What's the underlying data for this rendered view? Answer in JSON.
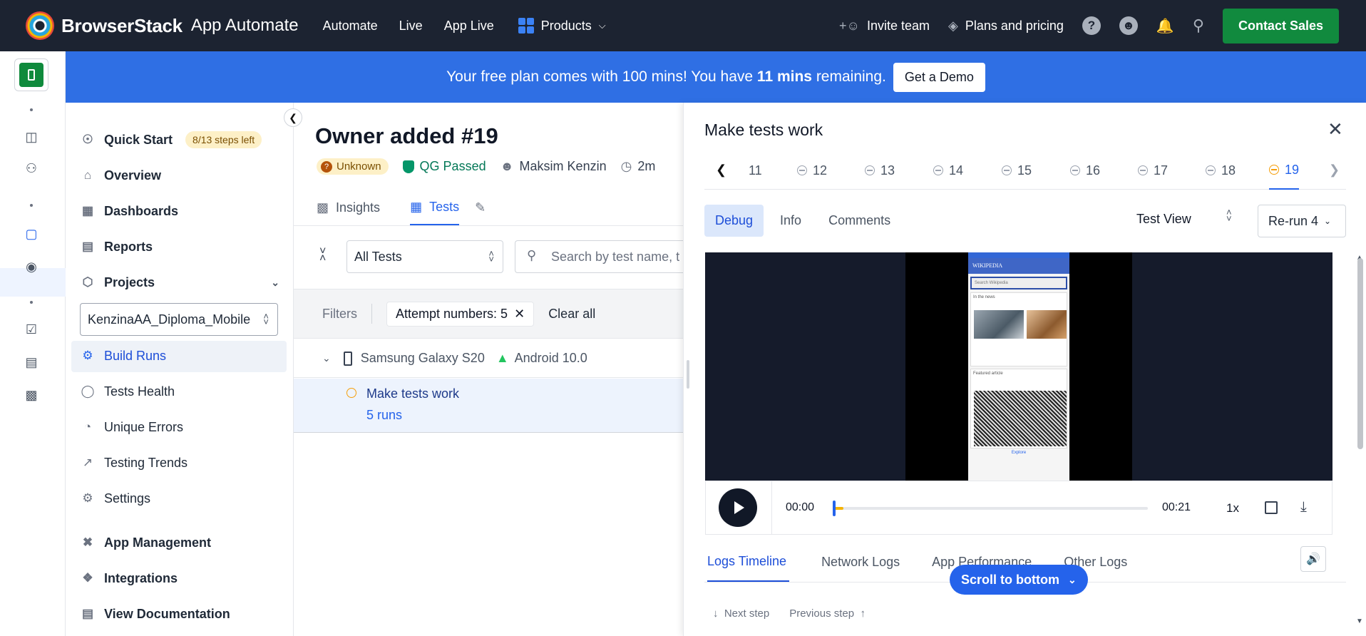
{
  "topnav": {
    "brand": "BrowserStack",
    "product": "App Automate",
    "links": [
      "Automate",
      "Live",
      "App Live"
    ],
    "products_label": "Products",
    "invite": "Invite team",
    "pricing": "Plans and pricing",
    "contact": "Contact Sales"
  },
  "banner": {
    "text_pre": "Your free plan comes with 100 mins! You have ",
    "mins": "11 mins",
    "text_post": " remaining.",
    "demo": "Get a Demo"
  },
  "sidebar": {
    "quick_start": "Quick Start",
    "steps_badge": "8/13 steps left",
    "overview": "Overview",
    "dashboards": "Dashboards",
    "reports": "Reports",
    "projects": "Projects",
    "project_select": "KenzinaAA_Diploma_Mobile",
    "build_runs": "Build Runs",
    "tests_health": "Tests Health",
    "unique_errors": "Unique Errors",
    "testing_trends": "Testing Trends",
    "settings": "Settings",
    "app_management": "App Management",
    "integrations": "Integrations",
    "view_docs": "View Documentation"
  },
  "build": {
    "title": "Owner added #19",
    "status": "Unknown",
    "qg": "QG Passed",
    "user": "Maksim Kenzin",
    "duration": "2m",
    "tabs": [
      "Insights",
      "Tests"
    ],
    "all_tests": "All Tests",
    "search_placeholder": "Search by test name, t",
    "filters_label": "Filters",
    "filter_chip": "Attempt numbers: 5",
    "clear_all": "Clear all",
    "device": "Samsung Galaxy S20",
    "os": "Android 10.0",
    "test_name": "Make tests work",
    "runs": "5 runs"
  },
  "panel": {
    "title": "Make tests work",
    "runs": [
      "11",
      "12",
      "13",
      "14",
      "15",
      "16",
      "17",
      "18",
      "19"
    ],
    "active_run": "19",
    "sub_tabs": [
      "Debug",
      "Info",
      "Comments"
    ],
    "test_view": "Test View",
    "rerun": "Re-run 4",
    "video": {
      "current": "00:00",
      "end": "00:21",
      "speed": "1x",
      "progress": 0.03
    },
    "phone": {
      "app_title": "WIKIPEDIA",
      "search": "Search Wikipedia",
      "card1": "In the news",
      "card2": "Featured article",
      "nav": "Explore"
    },
    "log_tabs": [
      "Logs Timeline",
      "Network Logs",
      "App Performance",
      "Other Logs"
    ],
    "scroll_bottom": "Scroll to bottom",
    "next_step": "Next step",
    "prev_step": "Previous step"
  }
}
